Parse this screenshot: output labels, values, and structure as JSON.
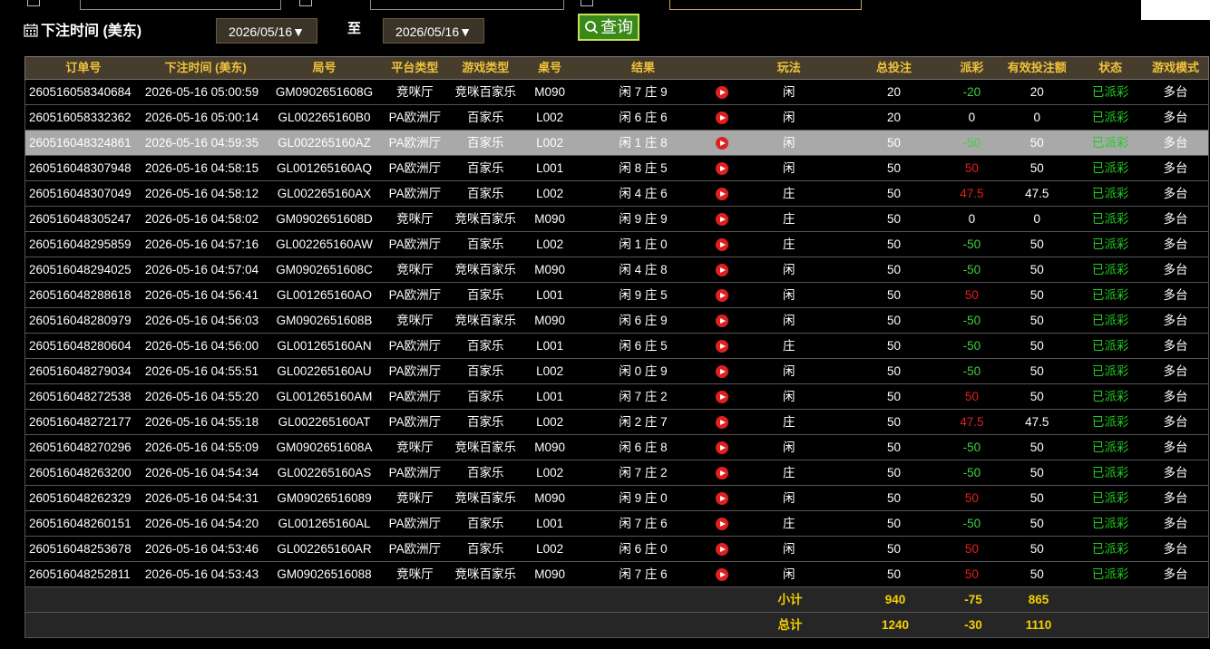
{
  "filter": {
    "label": "下注时间 (美东)",
    "start_date": "2026/05/16▼",
    "to_label": "至",
    "end_date": "2026/05/16▼",
    "query_label": "查询"
  },
  "colors": {
    "header_text": "#f0c23a",
    "positive": "#40d040",
    "negative": "#e02020",
    "status_text": "#22cc22",
    "summary_text": "#f5d000"
  },
  "table": {
    "headers": [
      "订单号",
      "下注时间 (美东)",
      "局号",
      "平台类型",
      "游戏类型",
      "桌号",
      "结果",
      "",
      "玩法",
      "总投注",
      "派彩",
      "有效投注额",
      "状态",
      "游戏模式"
    ],
    "rows": [
      {
        "order": "260516058340684",
        "time": "2026-05-16 05:00:59",
        "round": "GM0902651608G",
        "platform": "竞咪厅",
        "game_type": "竞咪百家乐",
        "table": "M090",
        "result": "闲 7 庄 9",
        "bet_type": "闲",
        "total": "20",
        "payout": "-20",
        "payout_color": "positive",
        "valid": "20",
        "status": "已派彩",
        "mode": "多台"
      },
      {
        "order": "260516058332362",
        "time": "2026-05-16 05:00:14",
        "round": "GL002265160B0",
        "platform": "PA欧洲厅",
        "game_type": "百家乐",
        "table": "L002",
        "result": "闲 6 庄 6",
        "bet_type": "闲",
        "total": "20",
        "payout": "0",
        "payout_color": "neutral",
        "valid": "0",
        "status": "已派彩",
        "mode": "多台"
      },
      {
        "order": "260516048324861",
        "time": "2026-05-16 04:59:35",
        "round": "GL002265160AZ",
        "platform": "PA欧洲厅",
        "game_type": "百家乐",
        "table": "L002",
        "result": "闲 1 庄 8",
        "bet_type": "闲",
        "total": "50",
        "payout": "-50",
        "payout_color": "positive",
        "valid": "50",
        "status": "已派彩",
        "mode": "多台",
        "selected": true
      },
      {
        "order": "260516048307948",
        "time": "2026-05-16 04:58:15",
        "round": "GL001265160AQ",
        "platform": "PA欧洲厅",
        "game_type": "百家乐",
        "table": "L001",
        "result": "闲 8 庄 5",
        "bet_type": "闲",
        "total": "50",
        "payout": "50",
        "payout_color": "negative",
        "valid": "50",
        "status": "已派彩",
        "mode": "多台"
      },
      {
        "order": "260516048307049",
        "time": "2026-05-16 04:58:12",
        "round": "GL002265160AX",
        "platform": "PA欧洲厅",
        "game_type": "百家乐",
        "table": "L002",
        "result": "闲 4 庄 6",
        "bet_type": "庄",
        "total": "50",
        "payout": "47.5",
        "payout_color": "negative",
        "valid": "47.5",
        "status": "已派彩",
        "mode": "多台"
      },
      {
        "order": "260516048305247",
        "time": "2026-05-16 04:58:02",
        "round": "GM0902651608D",
        "platform": "竞咪厅",
        "game_type": "竞咪百家乐",
        "table": "M090",
        "result": "闲 9 庄 9",
        "bet_type": "庄",
        "total": "50",
        "payout": "0",
        "payout_color": "neutral",
        "valid": "0",
        "status": "已派彩",
        "mode": "多台"
      },
      {
        "order": "260516048295859",
        "time": "2026-05-16 04:57:16",
        "round": "GL002265160AW",
        "platform": "PA欧洲厅",
        "game_type": "百家乐",
        "table": "L002",
        "result": "闲 1 庄 0",
        "bet_type": "庄",
        "total": "50",
        "payout": "-50",
        "payout_color": "positive",
        "valid": "50",
        "status": "已派彩",
        "mode": "多台"
      },
      {
        "order": "260516048294025",
        "time": "2026-05-16 04:57:04",
        "round": "GM0902651608C",
        "platform": "竞咪厅",
        "game_type": "竞咪百家乐",
        "table": "M090",
        "result": "闲 4 庄 8",
        "bet_type": "闲",
        "total": "50",
        "payout": "-50",
        "payout_color": "positive",
        "valid": "50",
        "status": "已派彩",
        "mode": "多台"
      },
      {
        "order": "260516048288618",
        "time": "2026-05-16 04:56:41",
        "round": "GL001265160AO",
        "platform": "PA欧洲厅",
        "game_type": "百家乐",
        "table": "L001",
        "result": "闲 9 庄 5",
        "bet_type": "闲",
        "total": "50",
        "payout": "50",
        "payout_color": "negative",
        "valid": "50",
        "status": "已派彩",
        "mode": "多台"
      },
      {
        "order": "260516048280979",
        "time": "2026-05-16 04:56:03",
        "round": "GM0902651608B",
        "platform": "竞咪厅",
        "game_type": "竞咪百家乐",
        "table": "M090",
        "result": "闲 6 庄 9",
        "bet_type": "闲",
        "total": "50",
        "payout": "-50",
        "payout_color": "positive",
        "valid": "50",
        "status": "已派彩",
        "mode": "多台"
      },
      {
        "order": "260516048280604",
        "time": "2026-05-16 04:56:00",
        "round": "GL001265160AN",
        "platform": "PA欧洲厅",
        "game_type": "百家乐",
        "table": "L001",
        "result": "闲 6 庄 5",
        "bet_type": "庄",
        "total": "50",
        "payout": "-50",
        "payout_color": "positive",
        "valid": "50",
        "status": "已派彩",
        "mode": "多台"
      },
      {
        "order": "260516048279034",
        "time": "2026-05-16 04:55:51",
        "round": "GL002265160AU",
        "platform": "PA欧洲厅",
        "game_type": "百家乐",
        "table": "L002",
        "result": "闲 0 庄 9",
        "bet_type": "闲",
        "total": "50",
        "payout": "-50",
        "payout_color": "positive",
        "valid": "50",
        "status": "已派彩",
        "mode": "多台"
      },
      {
        "order": "260516048272538",
        "time": "2026-05-16 04:55:20",
        "round": "GL001265160AM",
        "platform": "PA欧洲厅",
        "game_type": "百家乐",
        "table": "L001",
        "result": "闲 7 庄 2",
        "bet_type": "闲",
        "total": "50",
        "payout": "50",
        "payout_color": "negative",
        "valid": "50",
        "status": "已派彩",
        "mode": "多台"
      },
      {
        "order": "260516048272177",
        "time": "2026-05-16 04:55:18",
        "round": "GL002265160AT",
        "platform": "PA欧洲厅",
        "game_type": "百家乐",
        "table": "L002",
        "result": "闲 2 庄 7",
        "bet_type": "庄",
        "total": "50",
        "payout": "47.5",
        "payout_color": "negative",
        "valid": "47.5",
        "status": "已派彩",
        "mode": "多台"
      },
      {
        "order": "260516048270296",
        "time": "2026-05-16 04:55:09",
        "round": "GM0902651608A",
        "platform": "竞咪厅",
        "game_type": "竞咪百家乐",
        "table": "M090",
        "result": "闲 6 庄 8",
        "bet_type": "闲",
        "total": "50",
        "payout": "-50",
        "payout_color": "positive",
        "valid": "50",
        "status": "已派彩",
        "mode": "多台"
      },
      {
        "order": "260516048263200",
        "time": "2026-05-16 04:54:34",
        "round": "GL002265160AS",
        "platform": "PA欧洲厅",
        "game_type": "百家乐",
        "table": "L002",
        "result": "闲 7 庄 2",
        "bet_type": "庄",
        "total": "50",
        "payout": "-50",
        "payout_color": "positive",
        "valid": "50",
        "status": "已派彩",
        "mode": "多台"
      },
      {
        "order": "260516048262329",
        "time": "2026-05-16 04:54:31",
        "round": "GM09026516089",
        "platform": "竞咪厅",
        "game_type": "竞咪百家乐",
        "table": "M090",
        "result": "闲 9 庄 0",
        "bet_type": "闲",
        "total": "50",
        "payout": "50",
        "payout_color": "negative",
        "valid": "50",
        "status": "已派彩",
        "mode": "多台"
      },
      {
        "order": "260516048260151",
        "time": "2026-05-16 04:54:20",
        "round": "GL001265160AL",
        "platform": "PA欧洲厅",
        "game_type": "百家乐",
        "table": "L001",
        "result": "闲 7 庄 6",
        "bet_type": "庄",
        "total": "50",
        "payout": "-50",
        "payout_color": "positive",
        "valid": "50",
        "status": "已派彩",
        "mode": "多台"
      },
      {
        "order": "260516048253678",
        "time": "2026-05-16 04:53:46",
        "round": "GL002265160AR",
        "platform": "PA欧洲厅",
        "game_type": "百家乐",
        "table": "L002",
        "result": "闲 6 庄 0",
        "bet_type": "闲",
        "total": "50",
        "payout": "50",
        "payout_color": "negative",
        "valid": "50",
        "status": "已派彩",
        "mode": "多台"
      },
      {
        "order": "260516048252811",
        "time": "2026-05-16 04:53:43",
        "round": "GM09026516088",
        "platform": "竞咪厅",
        "game_type": "竞咪百家乐",
        "table": "M090",
        "result": "闲 7 庄 6",
        "bet_type": "闲",
        "total": "50",
        "payout": "50",
        "payout_color": "negative",
        "valid": "50",
        "status": "已派彩",
        "mode": "多台"
      }
    ],
    "subtotal": {
      "label": "小计",
      "total": "940",
      "payout": "-75",
      "valid": "865"
    },
    "grand_total": {
      "label": "总计",
      "total": "1240",
      "payout": "-30",
      "valid": "1110"
    }
  }
}
